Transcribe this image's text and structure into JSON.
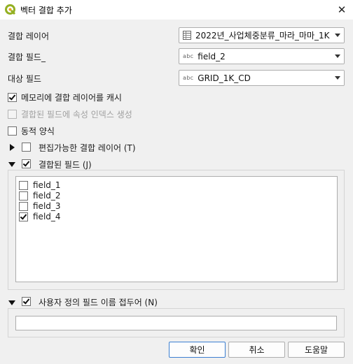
{
  "window": {
    "title": "벡터 결합 추가",
    "close_glyph": "✕"
  },
  "form": {
    "join_layer_label": "결합 레이어",
    "join_layer_value": "2022년_사업체중분류_마라_마마_1K",
    "join_field_label": "결합 필드_",
    "join_field_value": "field_2",
    "target_field_label": "대상 필드",
    "target_field_value": "GRID_1K_CD",
    "field_type_tag": "abc"
  },
  "options": {
    "cache_in_memory": {
      "label": "메모리에 결합 레이어를 캐시",
      "checked": true
    },
    "create_index": {
      "label": "결합된 필드에 속성 인덱스 생성",
      "checked": false,
      "disabled": true
    },
    "dynamic_form": {
      "label": "동적 양식",
      "checked": false
    },
    "editable_join": {
      "label": "편집가능한 결합 레이어 (T)",
      "checked": false,
      "expanded": false
    },
    "joined_fields": {
      "label": "결합된 필드 (J)",
      "checked": true,
      "expanded": true
    },
    "custom_prefix": {
      "label": "사용자 정의 필드 이름 접두어 (N)",
      "checked": true,
      "expanded": true
    }
  },
  "joined_fields_list": [
    {
      "label": "field_1",
      "checked": false
    },
    {
      "label": "field_2",
      "checked": false
    },
    {
      "label": "field_3",
      "checked": false
    },
    {
      "label": "field_4",
      "checked": true
    }
  ],
  "prefix_value": "",
  "buttons": {
    "ok": "확인",
    "cancel": "취소",
    "help": "도움말"
  },
  "colors": {
    "qgis_green": "#93b023",
    "primary_border": "#3c7fd1"
  }
}
